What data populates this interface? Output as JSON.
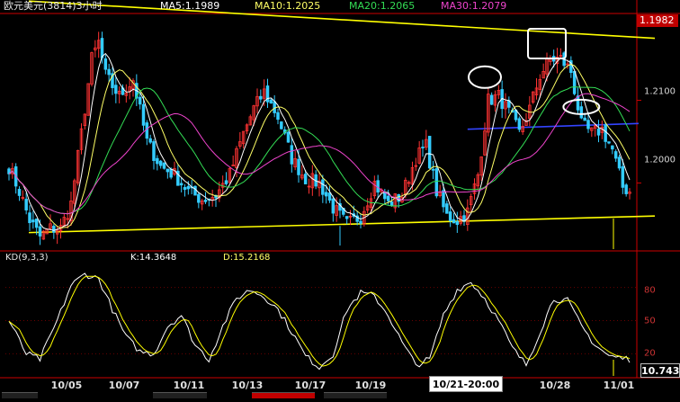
{
  "header": {
    "symbol": "欧元美元(3814)3小时",
    "ma5": "MA5:1.1989",
    "ma10": "MA10:1.2025",
    "ma20": "MA20:1.2065",
    "ma30": "MA30:1.2079"
  },
  "kd_header": {
    "name": "KD(9,3,3)",
    "k": "K:14.3648",
    "d": "D:15.2168"
  },
  "price_axis": {
    "labels": [
      "1.2100",
      "1.2000"
    ],
    "last_price": "1.1982"
  },
  "kd_axis": {
    "labels": [
      "80",
      "50",
      "20"
    ]
  },
  "x_axis": {
    "labels": [
      "10/05",
      "10/07",
      "10/11",
      "10/13",
      "10/17",
      "10/19",
      "10/28",
      "11/01"
    ],
    "cursor_label": "10/21-20:00"
  },
  "readout": "10.743",
  "colors": {
    "background": "#000000",
    "bull": "#ff3333",
    "bear": "#33ccff",
    "ma5": "#ffffff",
    "ma10": "#ffff66",
    "ma20": "#33dd55",
    "ma30": "#ee44cc",
    "trendline": "#ffff00",
    "neckline": "#3344ff",
    "k_line": "#ffffff",
    "d_line": "#ffff00",
    "frame": "#cc0000"
  },
  "chart_data": {
    "type": "candlestick",
    "ylim": [
      1.192,
      1.2205
    ],
    "kd_ylim": [
      0,
      100
    ],
    "anchors": [
      [
        0,
        1.202
      ],
      [
        3,
        1.199
      ],
      [
        6,
        1.1955
      ],
      [
        9,
        1.1935
      ],
      [
        12,
        1.1945
      ],
      [
        15,
        1.1945
      ],
      [
        18,
        1.1975
      ],
      [
        21,
        1.206
      ],
      [
        24,
        1.215
      ],
      [
        26,
        1.217
      ],
      [
        28,
        1.213
      ],
      [
        32,
        1.2105
      ],
      [
        36,
        1.2125
      ],
      [
        40,
        1.205
      ],
      [
        44,
        1.202
      ],
      [
        48,
        1.201
      ],
      [
        52,
        1.199
      ],
      [
        56,
        1.198
      ],
      [
        60,
        1.1985
      ],
      [
        64,
        1.201
      ],
      [
        68,
        1.206
      ],
      [
        71,
        1.209
      ],
      [
        74,
        1.211
      ],
      [
        78,
        1.208
      ],
      [
        82,
        1.203
      ],
      [
        86,
        1.2005
      ],
      [
        90,
        1.2
      ],
      [
        94,
        1.197
      ],
      [
        98,
        1.195
      ],
      [
        102,
        1.196
      ],
      [
        106,
        1.2
      ],
      [
        110,
        1.1975
      ],
      [
        114,
        1.1985
      ],
      [
        118,
        1.203
      ],
      [
        121,
        1.2045
      ],
      [
        124,
        1.199
      ],
      [
        127,
        1.196
      ],
      [
        130,
        1.1955
      ],
      [
        133,
        1.1965
      ],
      [
        136,
        1.201
      ],
      [
        139,
        1.21
      ],
      [
        142,
        1.2105
      ],
      [
        145,
        1.2085
      ],
      [
        148,
        1.206
      ],
      [
        151,
        1.209
      ],
      [
        154,
        1.213
      ],
      [
        157,
        1.215
      ],
      [
        160,
        1.215
      ],
      [
        163,
        1.2135
      ],
      [
        166,
        1.207
      ],
      [
        169,
        1.206
      ],
      [
        172,
        1.2065
      ],
      [
        175,
        1.204
      ],
      [
        178,
        1.1995
      ],
      [
        180,
        1.199
      ]
    ],
    "k_anchors": [
      [
        0,
        50
      ],
      [
        5,
        20
      ],
      [
        9,
        15
      ],
      [
        14,
        50
      ],
      [
        18,
        82
      ],
      [
        22,
        92
      ],
      [
        26,
        88
      ],
      [
        30,
        60
      ],
      [
        34,
        35
      ],
      [
        38,
        22
      ],
      [
        42,
        20
      ],
      [
        46,
        45
      ],
      [
        50,
        55
      ],
      [
        54,
        28
      ],
      [
        58,
        15
      ],
      [
        62,
        45
      ],
      [
        66,
        70
      ],
      [
        70,
        78
      ],
      [
        74,
        72
      ],
      [
        78,
        60
      ],
      [
        82,
        40
      ],
      [
        86,
        18
      ],
      [
        90,
        8
      ],
      [
        94,
        20
      ],
      [
        98,
        60
      ],
      [
        102,
        75
      ],
      [
        106,
        72
      ],
      [
        110,
        55
      ],
      [
        114,
        30
      ],
      [
        118,
        10
      ],
      [
        122,
        15
      ],
      [
        126,
        55
      ],
      [
        130,
        78
      ],
      [
        134,
        85
      ],
      [
        138,
        70
      ],
      [
        142,
        50
      ],
      [
        146,
        25
      ],
      [
        150,
        10
      ],
      [
        154,
        40
      ],
      [
        158,
        70
      ],
      [
        162,
        68
      ],
      [
        166,
        45
      ],
      [
        170,
        28
      ],
      [
        174,
        18
      ],
      [
        180,
        15
      ]
    ],
    "trendlines": [
      {
        "name": "upper",
        "from": [
          0,
          1.222
        ],
        "to": [
          180,
          1.2175
        ]
      },
      {
        "name": "lower",
        "from": [
          0,
          1.194
        ],
        "to": [
          180,
          1.196
        ]
      },
      {
        "name": "neckline",
        "from": [
          133,
          1.2065
        ],
        "to": [
          180,
          1.2072
        ]
      }
    ],
    "highlights": [
      {
        "shape": "ellipse",
        "bar": 138,
        "price": 1.2128
      },
      {
        "shape": "rect",
        "bar": 156,
        "price": 1.2168
      },
      {
        "shape": "ellipse",
        "bar": 166,
        "price": 1.2092
      }
    ]
  }
}
